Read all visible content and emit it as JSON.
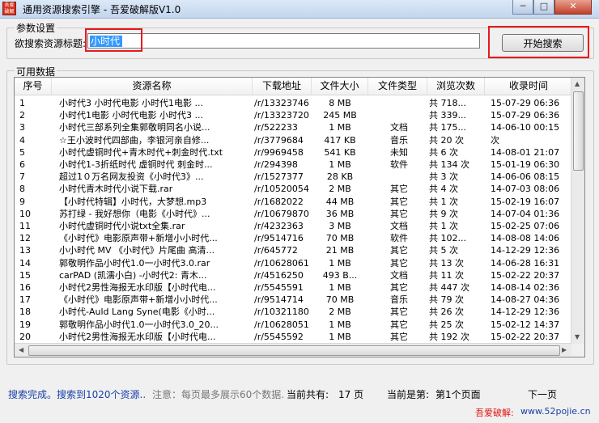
{
  "window": {
    "title": "通用资源搜索引擎 - 吾爱破解版V1.0",
    "icon_text": "吾爱破解",
    "min_glyph": "─",
    "max_glyph": "□",
    "close_glyph": "✕"
  },
  "params": {
    "group_title": "参数设置",
    "label": "欲搜索资源标题:",
    "value": "小时代",
    "start_button": "开始搜索"
  },
  "list": {
    "group_title": "可用数据",
    "columns": [
      "序号",
      "资源名称",
      "下载地址",
      "文件大小",
      "文件类型",
      "浏览次数",
      "收录时间"
    ],
    "rows": [
      [
        "1",
        "小时代3  小时代电影  小时代1电影 ...",
        "/r/13323746",
        "8 MB",
        "",
        "共 718...",
        "15-07-29 06:36"
      ],
      [
        "2",
        "小时代1电影  小时代电影  小时代3 ...",
        "/r/13323720",
        "245 MB",
        "",
        "共 339...",
        "15-07-29 06:36"
      ],
      [
        "3",
        "小时代三部系列全集郭敬明同名小说...",
        "/r/522233",
        "1 MB",
        "文档",
        "共 175...",
        "14-06-10 00:15"
      ],
      [
        "4",
        "☆王小波时代四部曲，李银河亲自修...",
        "/r/3779684",
        "417 KB",
        "音乐",
        "共 20 次",
        "次"
      ],
      [
        "5",
        "小时代虚铜时代+青木时代+刺金时代.txt",
        "/r/9969458",
        "541 KB",
        "未知",
        "共 6 次",
        "14-08-01 21:07"
      ],
      [
        "6",
        "小时代1-3折纸时代 虚铜时代 刺金时...",
        "/r/294398",
        "1 MB",
        "软件",
        "共 134 次",
        "15-01-19 06:30"
      ],
      [
        "7",
        "超过1０万名网友投资《小时代3》...",
        "/r/1527377",
        "28 KB",
        "",
        "共 3 次",
        "14-06-06 08:15"
      ],
      [
        "8",
        "小时代青木时代小说下载.rar",
        "/r/10520054",
        "2 MB",
        "其它",
        "共 4 次",
        "14-07-03 08:06"
      ],
      [
        "9",
        "【小时代特辑】小时代，大梦想.mp3",
        "/r/1682022",
        "44 MB",
        "其它",
        "共 1 次",
        "15-02-19 16:07"
      ],
      [
        "10",
        "苏打绿 - 我好想你（电影《小时代》...",
        "/r/10679870",
        "36 MB",
        "其它",
        "共 9 次",
        "14-07-04 01:36"
      ],
      [
        "11",
        "小时代虚铜时代小说txt全集.rar",
        "/r/4232363",
        "3 MB",
        "文档",
        "共 1 次",
        "15-02-25 07:06"
      ],
      [
        "12",
        "《小时代》电影原声带+新增小小时代...",
        "/r/9514716",
        "70 MB",
        "软件",
        "共 102...",
        "14-08-08 14:06"
      ],
      [
        "13",
        "小小时代 MV 《小时代》片尾曲 高清...",
        "/r/645772",
        "21 MB",
        "其它",
        "共 5 次",
        "14-12-29 12:36"
      ],
      [
        "14",
        "郭敬明作品小时代1.0一小时代3.0.rar",
        "/r/10628061",
        "1 MB",
        "其它",
        "共 13 次",
        "14-06-28 16:31"
      ],
      [
        "15",
        "carPAD (凯濡小白) -小时代2: 青木...",
        "/r/4516250",
        "493 B...",
        "文档",
        "共 11 次",
        "15-02-22 20:37"
      ],
      [
        "16",
        "小时代2男性海报无水印版【小时代电...",
        "/r/5545591",
        "1 MB",
        "其它",
        "共 447 次",
        "14-08-14 02:36"
      ],
      [
        "17",
        "《小时代》电影原声带+新增小小时代...",
        "/r/9514714",
        "70 MB",
        "音乐",
        "共 79 次",
        "14-08-27 04:36"
      ],
      [
        "18",
        "小时代-Auld Lang Syne(电影《小时...",
        "/r/10321180",
        "2 MB",
        "其它",
        "共 26 次",
        "14-12-29 12:36"
      ],
      [
        "19",
        "郭敬明作品小时代1.0一小时代3.0_20...",
        "/r/10628051",
        "1 MB",
        "其它",
        "共 25 次",
        "15-02-12 14:37"
      ],
      [
        "20",
        "小时代2男性海报无水印版【小时代电...",
        "/r/5545592",
        "1 MB",
        "其它",
        "共 192 次",
        "15-02-22 20:37"
      ]
    ]
  },
  "status": {
    "done": "搜索完成。搜索到1020个资源..",
    "note": "注意：每页最多展示60个数据.",
    "total_label": "当前共有:",
    "total_value": "17 页",
    "current_label": "当前是第:",
    "current_value": "第1个页面",
    "next_button": "下一页",
    "brand_name": "吾爱破解:",
    "brand_url": "www.52pojie.cn"
  }
}
